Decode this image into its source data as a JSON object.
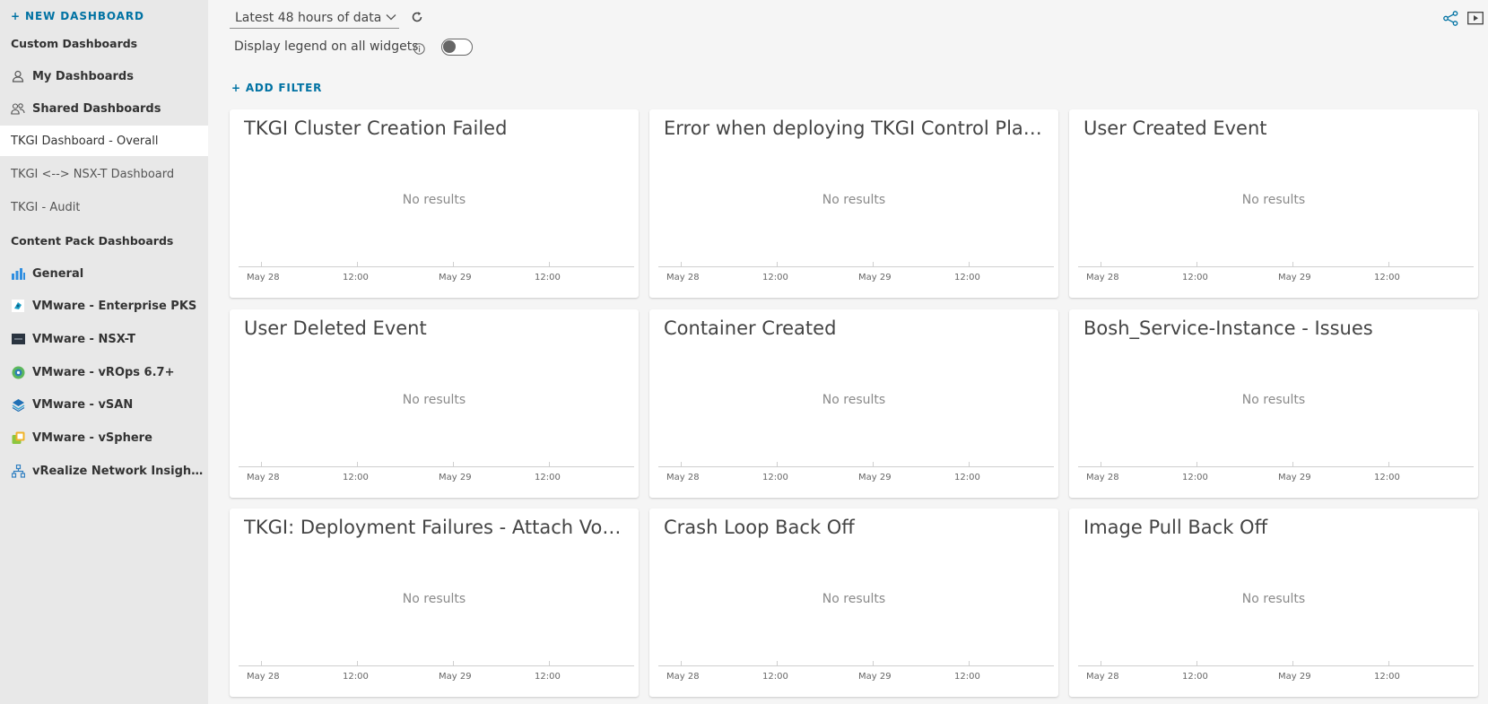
{
  "sidebar": {
    "new_dashboard": "+ NEW DASHBOARD",
    "custom_heading": "Custom Dashboards",
    "my_dashboards": "My Dashboards",
    "shared_dashboards": "Shared Dashboards",
    "dashboards": [
      {
        "label": "TKGI Dashboard - Overall",
        "active": true
      },
      {
        "label": "TKGI <--> NSX-T Dashboard",
        "active": false
      },
      {
        "label": "TKGI - Audit",
        "active": false
      }
    ],
    "content_pack_heading": "Content Pack Dashboards",
    "content_packs": [
      {
        "label": "General",
        "icon": "bar-chart-icon"
      },
      {
        "label": "VMware - Enterprise PKS",
        "icon": "pks-icon"
      },
      {
        "label": "VMware - NSX-T",
        "icon": "nsx-icon"
      },
      {
        "label": "VMware - vROps 6.7+",
        "icon": "vrops-icon"
      },
      {
        "label": "VMware - vSAN",
        "icon": "vsan-icon"
      },
      {
        "label": "VMware - vSphere",
        "icon": "vsphere-icon"
      },
      {
        "label": "vRealize Network Insight C...",
        "icon": "network-insight-icon"
      }
    ]
  },
  "header": {
    "time_range": "Latest 48 hours of data",
    "legend_label": "Display legend on all widgets",
    "legend_toggle_on": false,
    "add_filter": "+ ADD FILTER"
  },
  "widget_axis_labels": [
    "May 28",
    "12:00",
    "May 29",
    "12:00"
  ],
  "widgets": [
    {
      "title": "TKGI Cluster Creation Failed",
      "message": "No results"
    },
    {
      "title": "Error when deploying TKGI Control Plane VM",
      "message": "No results"
    },
    {
      "title": "User Created Event",
      "message": "No results"
    },
    {
      "title": "User Deleted Event",
      "message": "No results"
    },
    {
      "title": "Container Created",
      "message": "No results"
    },
    {
      "title": "Bosh_Service-Instance - Issues",
      "message": "No results"
    },
    {
      "title": "TKGI: Deployment Failures - Attach Volume Failed",
      "message": "No results"
    },
    {
      "title": "Crash Loop Back Off",
      "message": "No results"
    },
    {
      "title": "Image Pull Back Off",
      "message": "No results"
    }
  ],
  "colors": {
    "accent": "#0072a3",
    "sidebar_bg": "#e8e8e8",
    "page_bg": "#f5f5f5"
  }
}
